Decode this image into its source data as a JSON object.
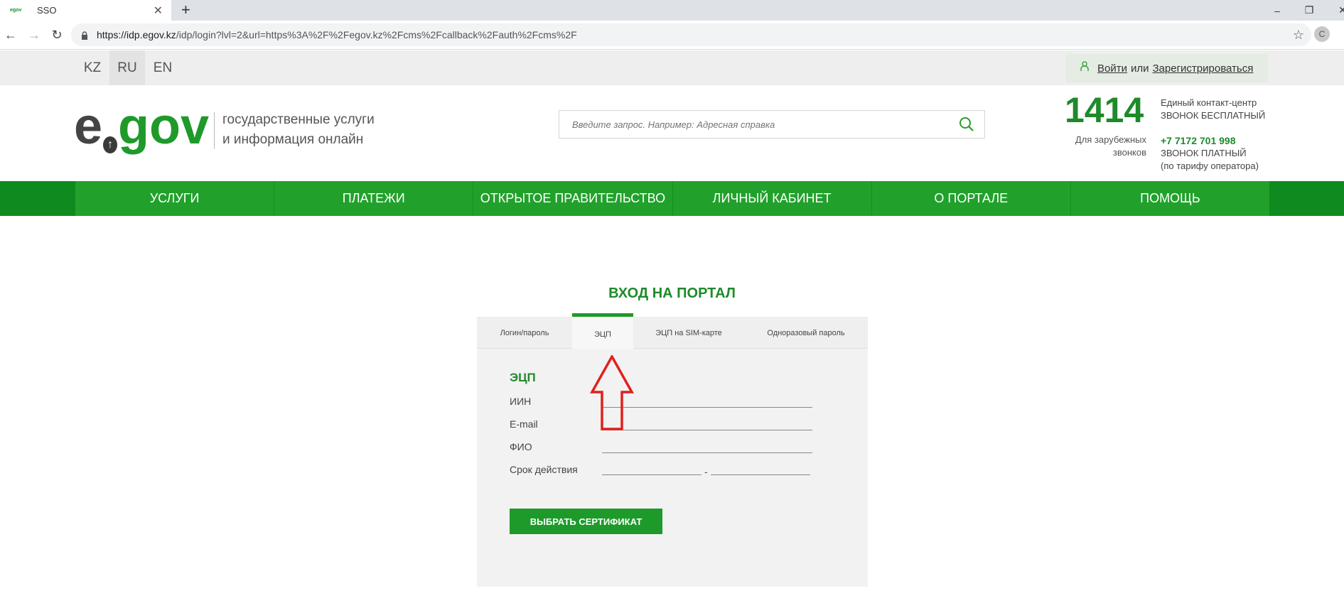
{
  "browser": {
    "tab_title": "SSO",
    "tab_favicon_text": "egov",
    "url_host": "https://idp.egov.kz",
    "url_path": "/idp/login?lvl=2&url=https%3A%2F%2Fegov.kz%2Fcms%2Fcallback%2Fauth%2Fcms%2F",
    "profile_initial": "C"
  },
  "topbar": {
    "languages": [
      "KZ",
      "RU",
      "EN"
    ],
    "active_language": "RU",
    "login_link": "Войти",
    "or_text": "или",
    "register_link": "Зарегистрироваться"
  },
  "header": {
    "logo_e": "e",
    "logo_gov": "gov",
    "tagline_line1": "государственные услуги",
    "tagline_line2": "и информация онлайн",
    "search_placeholder": "Введите запрос. Например: Адресная справка",
    "phone_short": "1414",
    "contact_center": "Единый контакт-центр",
    "free_call": "ЗВОНОК БЕСПЛАТНЫЙ",
    "abroad_calls": "Для зарубежных звонков",
    "phone_paid": "+7 7172 701 998",
    "paid_call": "ЗВОНОК ПЛАТНЫЙ",
    "operator_rate": "(по тарифу оператора)"
  },
  "nav": {
    "items": [
      "УСЛУГИ",
      "ПЛАТЕЖИ",
      "ОТКРЫТОЕ ПРАВИТЕЛЬСТВО",
      "ЛИЧНЫЙ КАБИНЕТ",
      "О ПОРТАЛЕ",
      "ПОМОЩЬ"
    ]
  },
  "login": {
    "title": "ВХОД НА ПОРТАЛ",
    "tabs": [
      "Логин/пароль",
      "ЭЦП",
      "ЭЦП на SIM-карте",
      "Одноразовый пароль"
    ],
    "active_tab": "ЭЦП",
    "section_heading": "ЭЦП",
    "fields": {
      "iin": "ИИН",
      "email": "E-mail",
      "fio": "ФИО",
      "validity": "Срок действия"
    },
    "validity_separator": "-",
    "select_button": "ВЫБРАТЬ СЕРТИФИКАТ"
  },
  "colors": {
    "brand_green": "#1f9a2a",
    "nav_green": "#21a12b",
    "annotation_red": "#e0201c"
  }
}
